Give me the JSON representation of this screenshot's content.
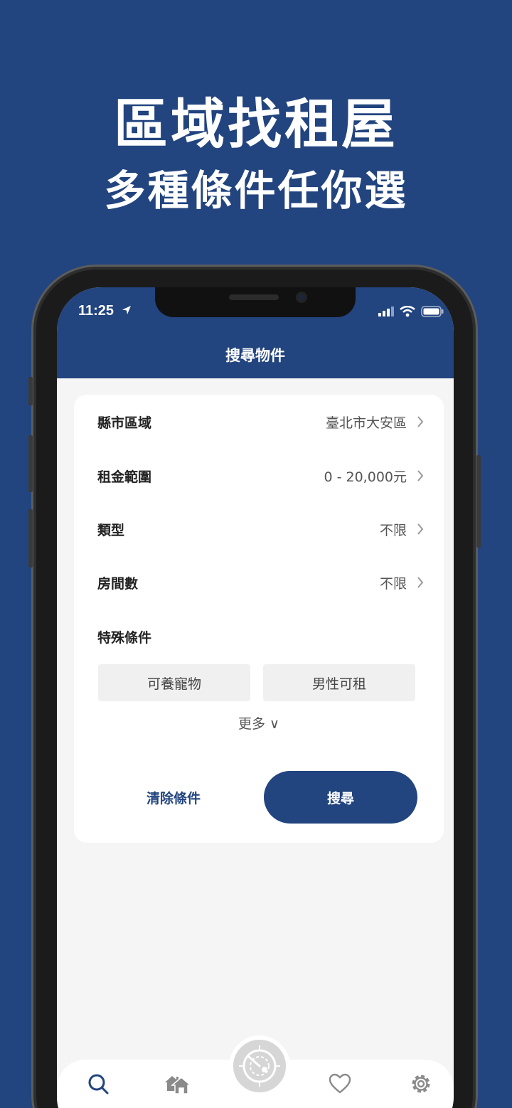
{
  "promo": {
    "title": "區域找租屋",
    "subtitle": "多種條件任你選"
  },
  "status_bar": {
    "time": "11:25"
  },
  "header": {
    "title": "搜尋物件"
  },
  "filters": [
    {
      "label": "縣市區域",
      "value": "臺北市大安區"
    },
    {
      "label": "租金範圍",
      "value": "0 - 20,000元"
    },
    {
      "label": "類型",
      "value": "不限"
    },
    {
      "label": "房間數",
      "value": "不限"
    }
  ],
  "special": {
    "label": "特殊條件",
    "options": [
      "可養寵物",
      "男性可租"
    ],
    "more": "更多 ∨"
  },
  "actions": {
    "clear": "清除條件",
    "search": "搜尋"
  },
  "tabbar": {
    "items": [
      "search-icon",
      "home-icon",
      "radar-icon",
      "heart-icon",
      "gear-icon"
    ]
  },
  "colors": {
    "brand": "#22447f",
    "background": "#f5f5f5",
    "chip": "#f0f0f0"
  }
}
